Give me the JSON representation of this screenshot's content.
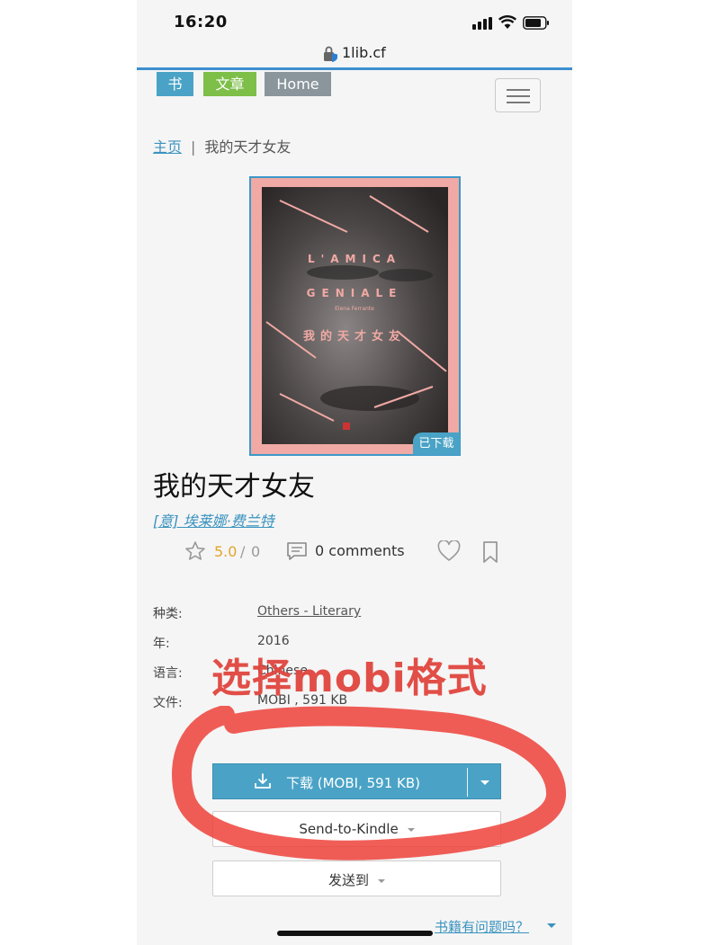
{
  "status_bar": {
    "time": "16:20"
  },
  "browser": {
    "url": "1lib.cf"
  },
  "nav": {
    "tabs": [
      {
        "label": "书",
        "color": "#4aa3c6"
      },
      {
        "label": "文章",
        "color": "#7dbf48"
      },
      {
        "label": "Home",
        "color": "#8a959c"
      }
    ],
    "menu_icon": "hamburger-icon"
  },
  "breadcrumb": {
    "home": "主页",
    "separator": "|",
    "current": "我的天才女友"
  },
  "cover": {
    "text_line1": "L'AMICA",
    "text_line2": "GENIALE",
    "author_en": "Elena Ferrante",
    "title_cn": "我的天才女友",
    "badge": "已下载"
  },
  "book": {
    "title": "我的天才女友",
    "author": "[意] 埃莱娜·费兰特",
    "rating": "5.0",
    "rating_separator": "/",
    "rating_count": "0",
    "comments": "0 comments"
  },
  "details": [
    {
      "label": "种类:",
      "value": "Others - Literary",
      "is_link": true
    },
    {
      "label": "年:",
      "value": "2016",
      "is_link": false
    },
    {
      "label": "语言:",
      "value": "Chinese",
      "is_link": false
    },
    {
      "label": "文件:",
      "value": "MOBI , 591 KB",
      "is_link": false
    }
  ],
  "actions": {
    "download": "下载 (MOBI, 591 KB)",
    "send_to_kindle": "Send-to-Kindle",
    "send_to": "发送到",
    "problem": "书籍有问题吗？"
  },
  "annotation": {
    "text": "选择mobi格式",
    "color": "#e0463e"
  },
  "colors": {
    "accent": "#4aa3c6",
    "link": "#3a93bf",
    "rating": "#e4a42c"
  }
}
